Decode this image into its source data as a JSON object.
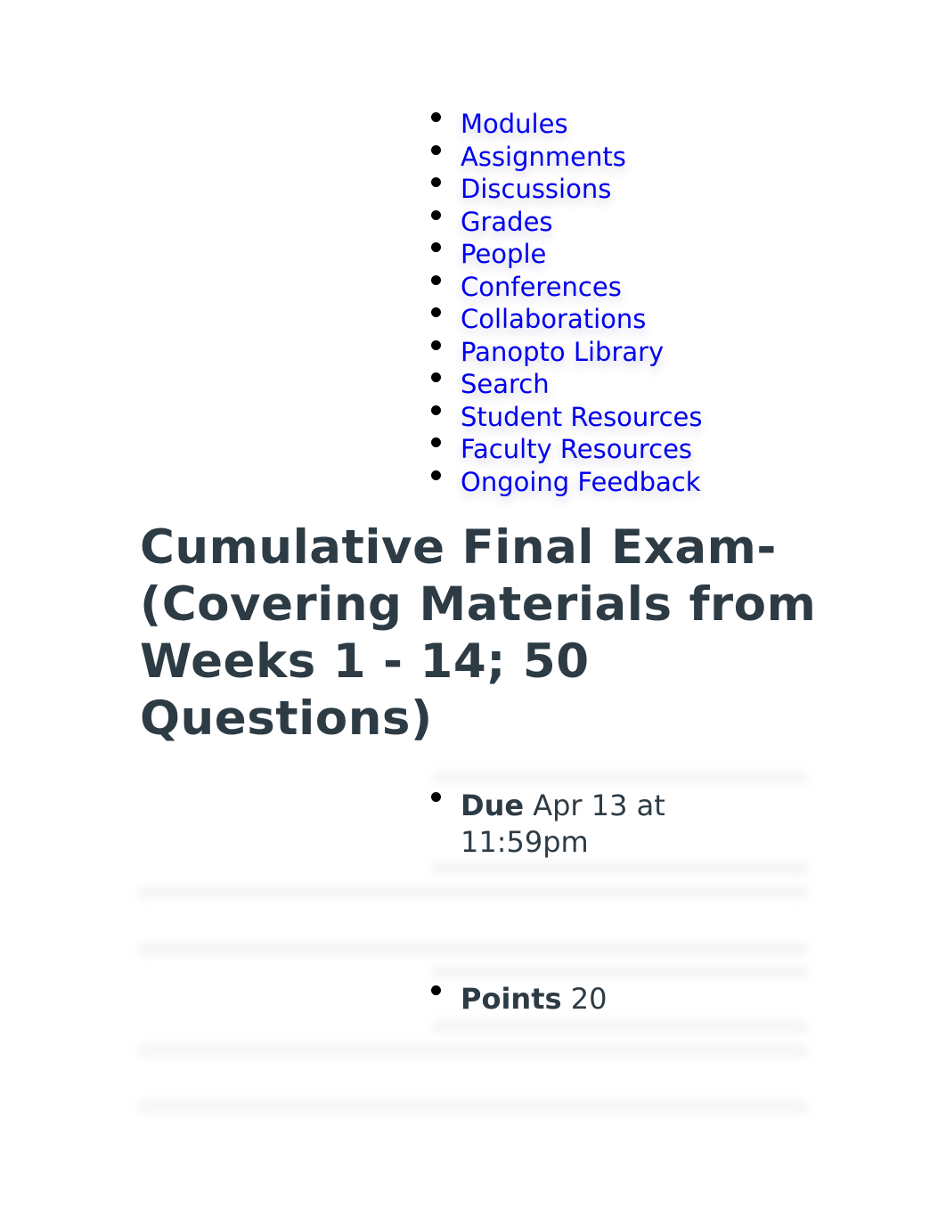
{
  "nav": {
    "items": [
      {
        "label": "Modules"
      },
      {
        "label": "Assignments"
      },
      {
        "label": "Discussions"
      },
      {
        "label": "Grades"
      },
      {
        "label": "People"
      },
      {
        "label": "Conferences"
      },
      {
        "label": "Collaborations"
      },
      {
        "label": "Panopto Library"
      },
      {
        "label": "Search"
      },
      {
        "label": "Student Resources"
      },
      {
        "label": "Faculty Resources"
      },
      {
        "label": "Ongoing Feedback"
      }
    ],
    "link_color": "#0000ee"
  },
  "assignment": {
    "title": "Cumulative Final Exam-(Covering Materials from Weeks 1 - 14; 50 Questions)",
    "title_color": "#2d3b45",
    "due": {
      "label": "Due",
      "value": "Apr 13 at 11:59pm"
    },
    "points": {
      "label": "Points",
      "value": "20"
    }
  }
}
